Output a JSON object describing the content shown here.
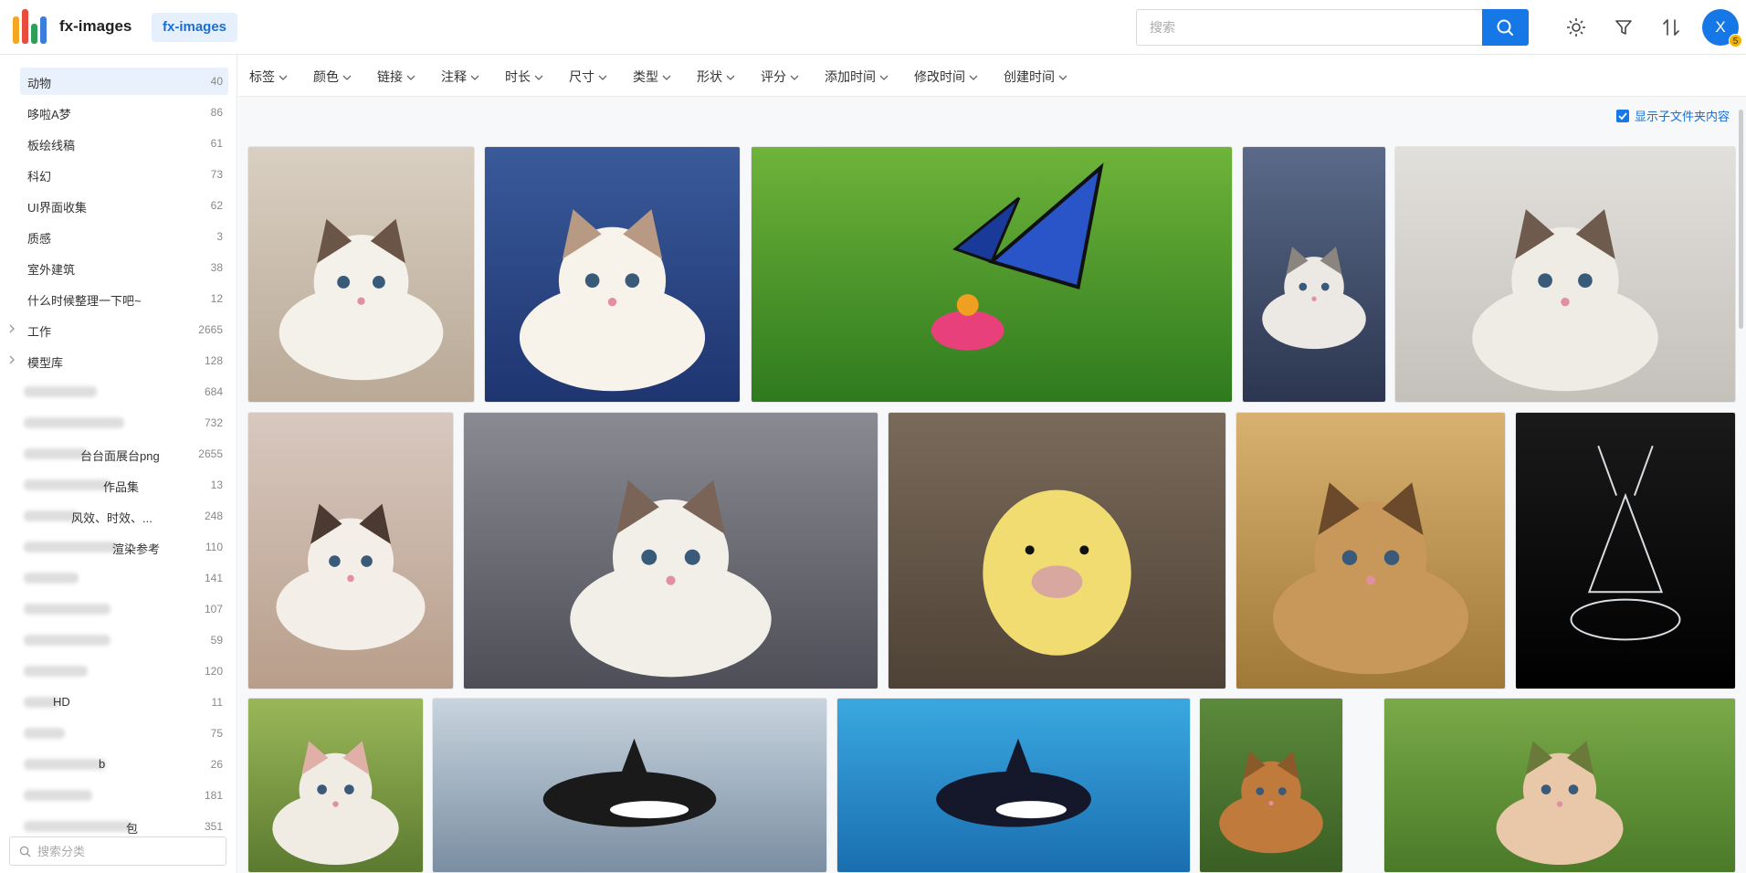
{
  "header": {
    "app_title": "fx-images",
    "library_tab": "fx-images",
    "search_placeholder": "搜索",
    "avatar_letter": "X",
    "avatar_badge": "5",
    "icons": [
      "search-icon",
      "theme-sun-icon",
      "filter-icon",
      "sort-icon"
    ]
  },
  "sidebar": {
    "items": [
      {
        "label": "动物",
        "count": "40",
        "active": true
      },
      {
        "label": "哆啦A梦",
        "count": "86"
      },
      {
        "label": "板绘线稿",
        "count": "61"
      },
      {
        "label": "科幻",
        "count": "73"
      },
      {
        "label": "UI界面收集",
        "count": "62"
      },
      {
        "label": "质感",
        "count": "3"
      },
      {
        "label": "室外建筑",
        "count": "38"
      },
      {
        "label": "什么时候整理一下吧~",
        "count": "12"
      },
      {
        "label": "工作",
        "count": "2665",
        "expandable": true
      },
      {
        "label": "模型库",
        "count": "128",
        "expandable": true
      },
      {
        "label": "",
        "count": "684"
      },
      {
        "label": "",
        "count": "732"
      },
      {
        "label": "台台面展台png",
        "count": "2655"
      },
      {
        "label": "作品集",
        "count": "13"
      },
      {
        "label": "风效、时效、...",
        "count": "248"
      },
      {
        "label": "渲染参考",
        "count": "110"
      },
      {
        "label": "",
        "count": "141"
      },
      {
        "label": "",
        "count": "107"
      },
      {
        "label": "",
        "count": "59"
      },
      {
        "label": "",
        "count": "120"
      },
      {
        "label": "HD",
        "count": "11"
      },
      {
        "label": "",
        "count": "75"
      },
      {
        "label": "b",
        "count": "26"
      },
      {
        "label": "",
        "count": "181"
      },
      {
        "label": "包",
        "count": "351"
      }
    ],
    "search_placeholder": "搜索分类"
  },
  "filters": [
    "标签",
    "颜色",
    "链接",
    "注释",
    "时长",
    "尺寸",
    "类型",
    "形状",
    "评分",
    "添加时间",
    "修改时间",
    "创建时间"
  ],
  "show_subfolder_label": "显示子文件夹内容",
  "show_subfolder_checked": true,
  "images": [
    "ragdoll-kitten-on-rug",
    "ragdoll-kitten-on-blue-blanket",
    "butterfly-on-pink-flower",
    "ragdoll-cat-sitting",
    "cat-lying-on-railing",
    "cat-sleeping-on-scratcher",
    "ragdoll-cat-on-fur-rug",
    "duckling-closeup",
    "baby-giraffe-on-straw",
    "crystal-deer",
    "lamb-on-grass",
    "orca-jumping",
    "orca-underwater",
    "spotted-deer",
    "lizard-in-hand"
  ],
  "colors": {
    "accent": "#1677e6",
    "active_bg": "#e8f1fc"
  }
}
